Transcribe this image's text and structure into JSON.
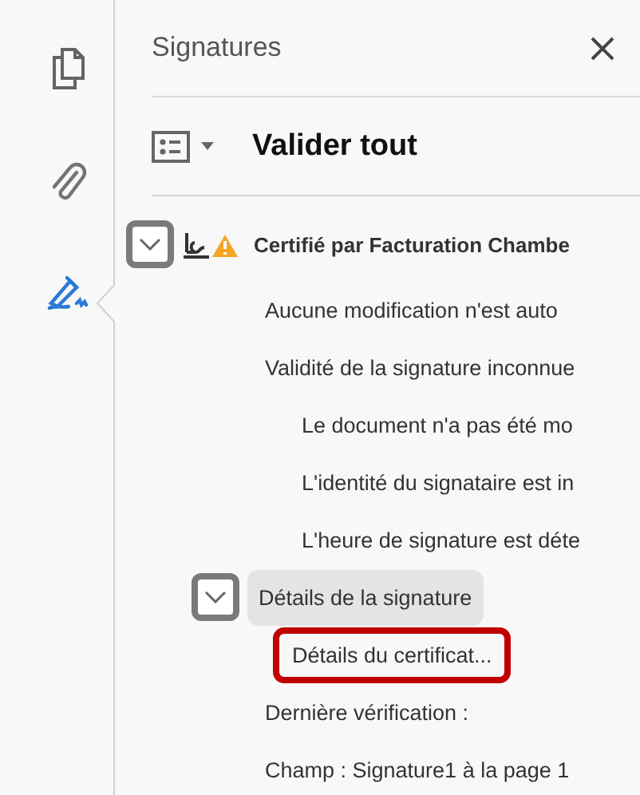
{
  "rail": [
    {
      "kind": "pages",
      "selected": false
    },
    {
      "kind": "attachments",
      "selected": false
    },
    {
      "kind": "signatures",
      "selected": true
    }
  ],
  "panel": {
    "title": "Signatures",
    "action": "Valider tout"
  },
  "tree": [
    {
      "kind": "signature",
      "label": "Certifié par Facturation Chambe",
      "selected": false,
      "annotated": false,
      "children": [
        {
          "kind": "item",
          "label": "Aucune modification n'est auto",
          "selected": false,
          "annotated": false
        },
        {
          "kind": "item",
          "label": "Validité de la signature inconnue",
          "selected": false,
          "annotated": false,
          "children": [
            {
              "kind": "item",
              "label": "Le document n'a pas été mo",
              "selected": false,
              "annotated": false
            },
            {
              "kind": "item",
              "label": "L'identité du signataire est in",
              "selected": false,
              "annotated": false
            },
            {
              "kind": "item",
              "label": "L'heure de signature est déte",
              "selected": false,
              "annotated": false
            }
          ]
        },
        {
          "kind": "section",
          "label": "Détails de la signature",
          "selected": true,
          "annotated": false,
          "children": [
            {
              "kind": "item",
              "label": "Détails du certificat...",
              "selected": false,
              "annotated": true
            }
          ]
        },
        {
          "kind": "item",
          "label": "Dernière vérification :",
          "selected": false,
          "annotated": false
        },
        {
          "kind": "item",
          "label": "Champ : Signature1 à la page 1",
          "selected": false,
          "annotated": false
        }
      ]
    }
  ]
}
